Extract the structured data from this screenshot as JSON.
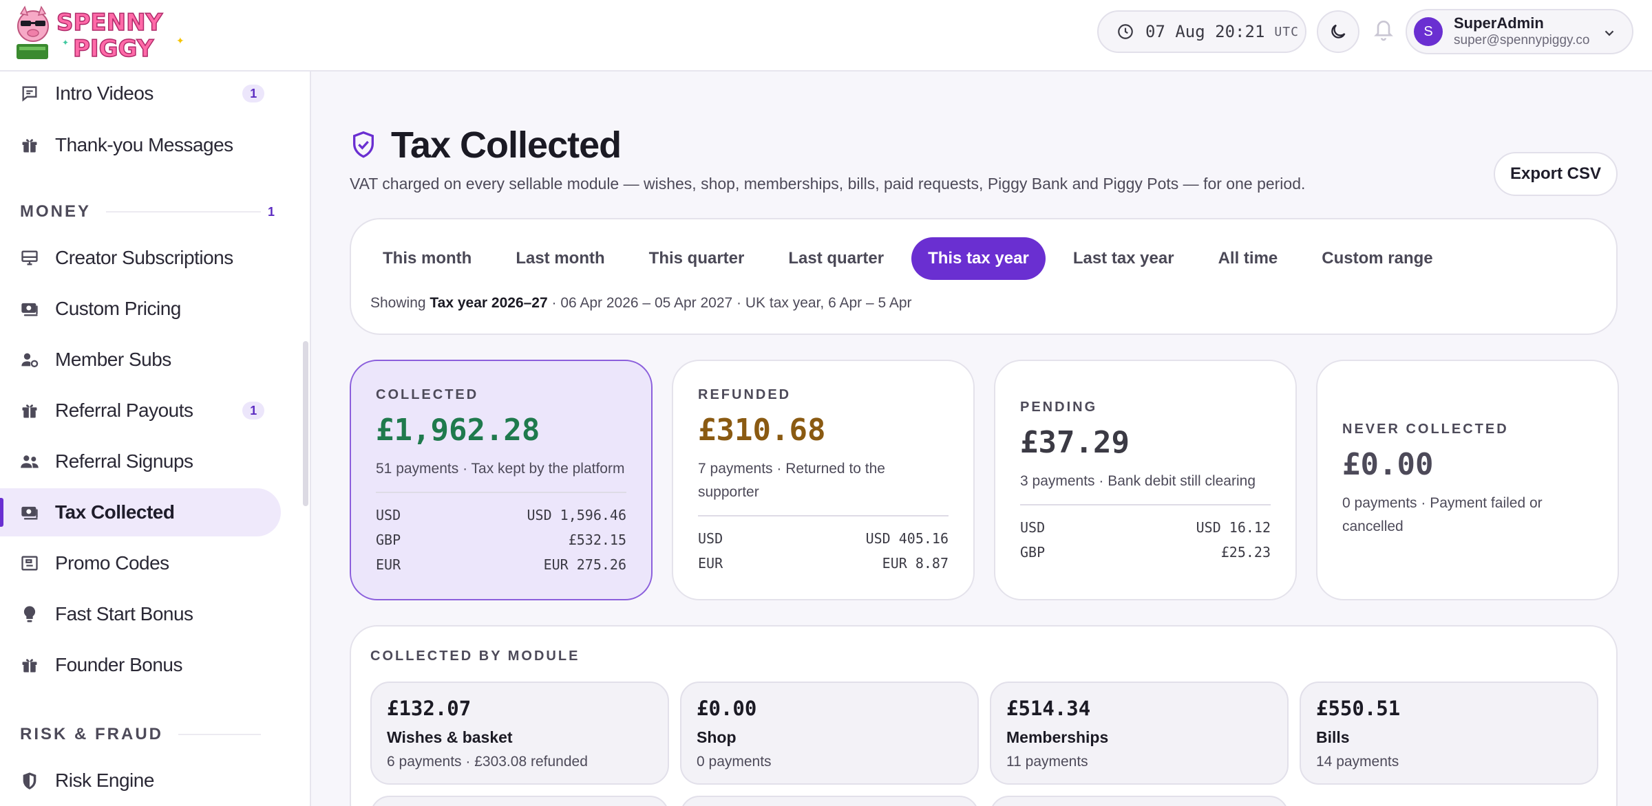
{
  "brand": {
    "logo_line1": "SPENNY",
    "logo_line2": "PIGGY"
  },
  "header": {
    "clock": "07 Aug 20:21",
    "timezone": "UTC",
    "user_name": "SuperAdmin",
    "user_email": "super@spennypiggy.co",
    "avatar_initial": "S"
  },
  "sidebar": {
    "items_top": [
      {
        "label": "Intro Videos",
        "icon": "chat-icon",
        "badge": "1"
      },
      {
        "label": "Thank-you Messages",
        "icon": "gift-icon",
        "badge": ""
      }
    ],
    "money_section": {
      "label": "MONEY",
      "count": "1"
    },
    "money_items": [
      {
        "label": "Creator Subscriptions",
        "icon": "monitor-icon",
        "badge": ""
      },
      {
        "label": "Custom Pricing",
        "icon": "cash-icon",
        "badge": ""
      },
      {
        "label": "Member Subs",
        "icon": "user-gear-icon",
        "badge": ""
      },
      {
        "label": "Referral Payouts",
        "icon": "gift-icon",
        "badge": "1"
      },
      {
        "label": "Referral Signups",
        "icon": "users-icon",
        "badge": ""
      },
      {
        "label": "Tax Collected",
        "icon": "cash-icon",
        "badge": "",
        "active": true
      },
      {
        "label": "Promo Codes",
        "icon": "ticket-icon",
        "badge": ""
      },
      {
        "label": "Fast Start Bonus",
        "icon": "bulb-icon",
        "badge": ""
      },
      {
        "label": "Founder Bonus",
        "icon": "gift-icon",
        "badge": ""
      }
    ],
    "risk_section": {
      "label": "RISK & FRAUD"
    },
    "risk_items": [
      {
        "label": "Risk Engine",
        "icon": "shield-icon",
        "badge": ""
      }
    ]
  },
  "page": {
    "title": "Tax Collected",
    "subtitle": "VAT charged on every sellable module — wishes, shop, memberships, bills, paid requests, Piggy Bank and Piggy Pots — for one period.",
    "export_label": "Export CSV",
    "tabs": [
      "This month",
      "Last month",
      "This quarter",
      "Last quarter",
      "This tax year",
      "Last tax year",
      "All time",
      "Custom range"
    ],
    "active_tab": "This tax year",
    "showing_prefix": "Showing",
    "showing_period": "Tax year 2026–27",
    "showing_suffix": " · 06 Apr 2026 – 05 Apr 2027 · UK tax year, 6 Apr – 5 Apr"
  },
  "stats": {
    "collected": {
      "label": "COLLECTED",
      "amount": "£1,962.28",
      "note": "51 payments · Tax kept by the platform",
      "color": "#1f7a4d",
      "rows": [
        [
          "USD",
          "USD 1,596.46"
        ],
        [
          "GBP",
          "£532.15"
        ],
        [
          "EUR",
          "EUR 275.26"
        ]
      ]
    },
    "refunded": {
      "label": "REFUNDED",
      "amount": "£310.68",
      "note": "7 payments · Returned to the supporter",
      "color": "#8a5a12",
      "rows": [
        [
          "USD",
          "USD 405.16"
        ],
        [
          "EUR",
          "EUR 8.87"
        ]
      ]
    },
    "pending": {
      "label": "PENDING",
      "amount": "£37.29",
      "note": "3 payments · Bank debit still clearing",
      "color": "#3b3a44",
      "rows": [
        [
          "USD",
          "USD 16.12"
        ],
        [
          "GBP",
          "£25.23"
        ]
      ]
    },
    "never": {
      "label": "NEVER COLLECTED",
      "amount": "£0.00",
      "note": "0 payments · Payment failed or cancelled",
      "color": "#4d4a59",
      "rows": []
    }
  },
  "modules": {
    "label": "COLLECTED BY MODULE",
    "items": [
      {
        "amount": "£132.07",
        "name": "Wishes & basket",
        "count": "6 payments · £303.08 refunded"
      },
      {
        "amount": "£0.00",
        "name": "Shop",
        "count": "0 payments"
      },
      {
        "amount": "£514.34",
        "name": "Memberships",
        "count": "11 payments"
      },
      {
        "amount": "£550.51",
        "name": "Bills",
        "count": "14 payments"
      }
    ]
  },
  "colors": {
    "accent": "#6a2fd1",
    "accent_soft": "#ece6fb"
  }
}
